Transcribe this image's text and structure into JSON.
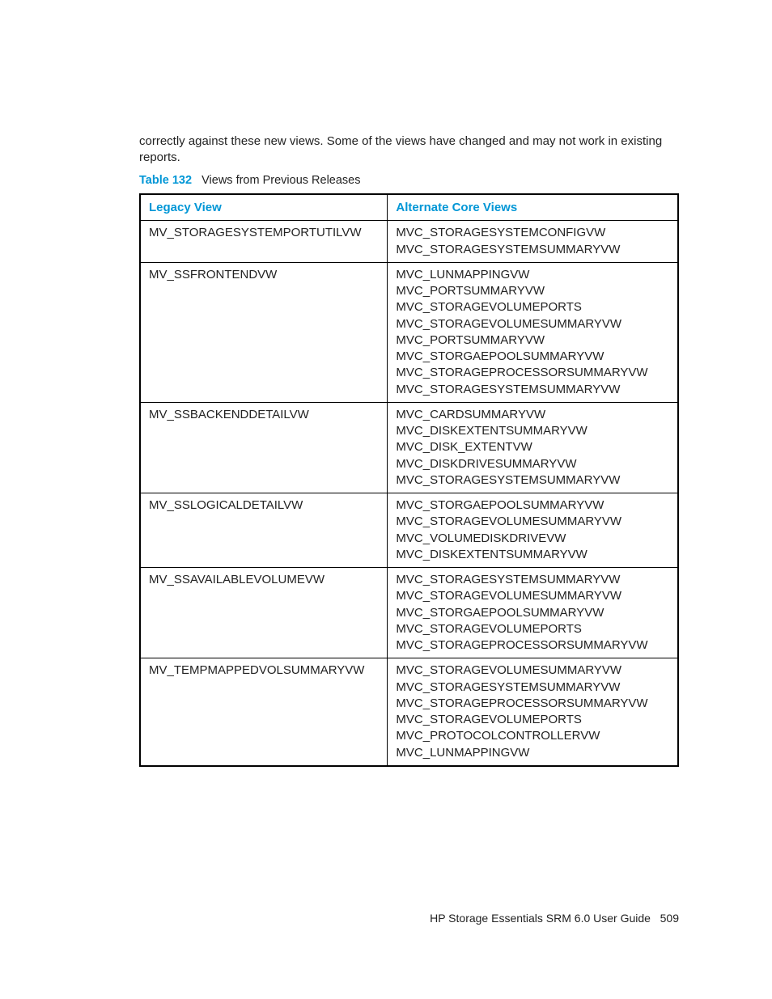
{
  "intro": "correctly against these new views. Some of the views have changed and may not work in existing reports.",
  "caption": {
    "number": "Table 132",
    "text": "Views from Previous Releases"
  },
  "columns": {
    "legacy": "Legacy View",
    "alternate": "Alternate Core Views"
  },
  "rows": [
    {
      "legacy": "MV_STORAGESYSTEMPORTUTILVW",
      "alt": [
        "MVC_STORAGESYSTEMCONFIGVW",
        "MVC_STORAGESYSTEMSUMMARYVW"
      ]
    },
    {
      "legacy": "MV_SSFRONTENDVW",
      "alt": [
        "MVC_LUNMAPPINGVW",
        "MVC_PORTSUMMARYVW",
        "MVC_STORAGEVOLUMEPORTS",
        "MVC_STORAGEVOLUMESUMMARYVW",
        "MVC_PORTSUMMARYVW",
        "MVC_STORGAEPOOLSUMMARYVW",
        "MVC_STORAGEPROCESSORSUMMARYVW",
        "MVC_STORAGESYSTEMSUMMARYVW"
      ]
    },
    {
      "legacy": "MV_SSBACKENDDETAILVW",
      "alt": [
        "MVC_CARDSUMMARYVW",
        "MVC_DISKEXTENTSUMMARYVW",
        "MVC_DISK_EXTENTVW",
        "MVC_DISKDRIVESUMMARYVW",
        "MVC_STORAGESYSTEMSUMMARYVW"
      ]
    },
    {
      "legacy": "MV_SSLOGICALDETAILVW",
      "alt": [
        "MVC_STORGAEPOOLSUMMARYVW",
        "MVC_STORAGEVOLUMESUMMARYVW",
        "MVC_VOLUMEDISKDRIVEVW",
        "MVC_DISKEXTENTSUMMARYVW"
      ]
    },
    {
      "legacy": "MV_SSAVAILABLEVOLUMEVW",
      "alt": [
        "MVC_STORAGESYSTEMSUMMARYVW",
        "MVC_STORAGEVOLUMESUMMARYVW",
        "MVC_STORGAEPOOLSUMMARYVW",
        "MVC_STORAGEVOLUMEPORTS",
        "MVC_STORAGEPROCESSORSUMMARYVW"
      ]
    },
    {
      "legacy": "MV_TEMPMAPPEDVOLSUMMARYVW",
      "alt": [
        "MVC_STORAGEVOLUMESUMMARYVW",
        "MVC_STORAGESYSTEMSUMMARYVW",
        "MVC_STORAGEPROCESSORSUMMARYVW",
        "MVC_STORAGEVOLUMEPORTS",
        "MVC_PROTOCOLCONTROLLERVW",
        "MVC_LUNMAPPINGVW"
      ]
    }
  ],
  "footer": {
    "title": "HP Storage Essentials SRM 6.0 User Guide",
    "page": "509"
  }
}
